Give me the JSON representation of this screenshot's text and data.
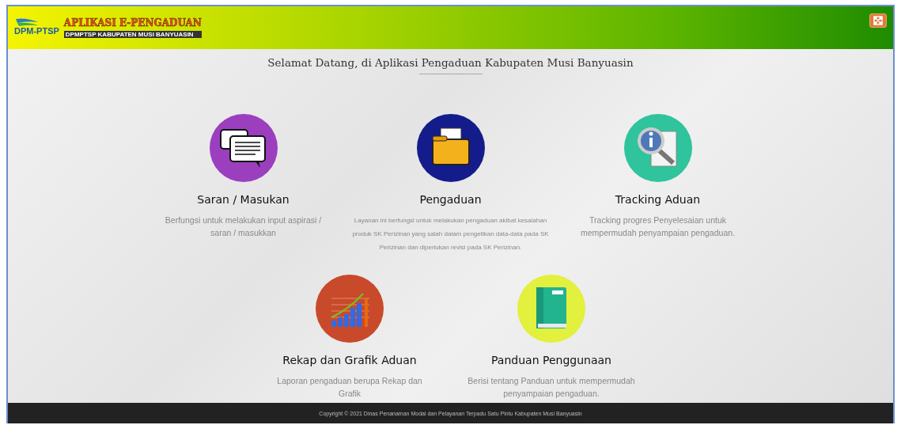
{
  "header": {
    "logo_text": "DPM-PTSP",
    "app_title": "APLIKASI E-PENGADUAN",
    "app_subtitle": "DPMPTSP KABUPATEN MUSI BANYUASIN"
  },
  "welcome": "Selamat Datang, di Aplikasi Pengaduan Kabupaten Musi Banyuasin",
  "rows": [
    {
      "cards": [
        {
          "kind": "chat",
          "color": "#9b3fbf",
          "title": "Saran / Masukan",
          "description": "Berfungsi untuk melakukan input aspirasi / saran / masukkan",
          "small": false
        },
        {
          "kind": "folder",
          "color": "#141c8c",
          "title": "Pengaduan",
          "description": "Layanan ini berfungsi untuk melakukan pengaduan akibat kesalahan produk SK Perizinan yang salah dalam pengetikan data-data pada SK Perizinan dan diperlukan revisi pada SK Perizinan.",
          "small": true
        },
        {
          "kind": "search",
          "color": "#2fc49c",
          "title": "Tracking Aduan",
          "description": "Tracking progres Penyelesaian untuk mempermudah penyampaian pengaduan.",
          "small": false
        }
      ]
    },
    {
      "cards": [
        {
          "kind": "chart",
          "color": "#c84a2a",
          "title": "Rekap dan Grafik Aduan",
          "description": "Laporan pengaduan berupa Rekap dan Grafik",
          "small": false
        },
        {
          "kind": "book",
          "color": "#e2f03e",
          "title": "Panduan Penggunaan",
          "description": "Berisi tentang Panduan untuk mempermudah penyampaian pengaduan.",
          "small": false
        }
      ]
    }
  ],
  "footer": "Copyright © 2021 Dinas Penanaman Modal dan Pelayanan Terpadu Satu Pintu Kabupaten Musi Banyuasin"
}
